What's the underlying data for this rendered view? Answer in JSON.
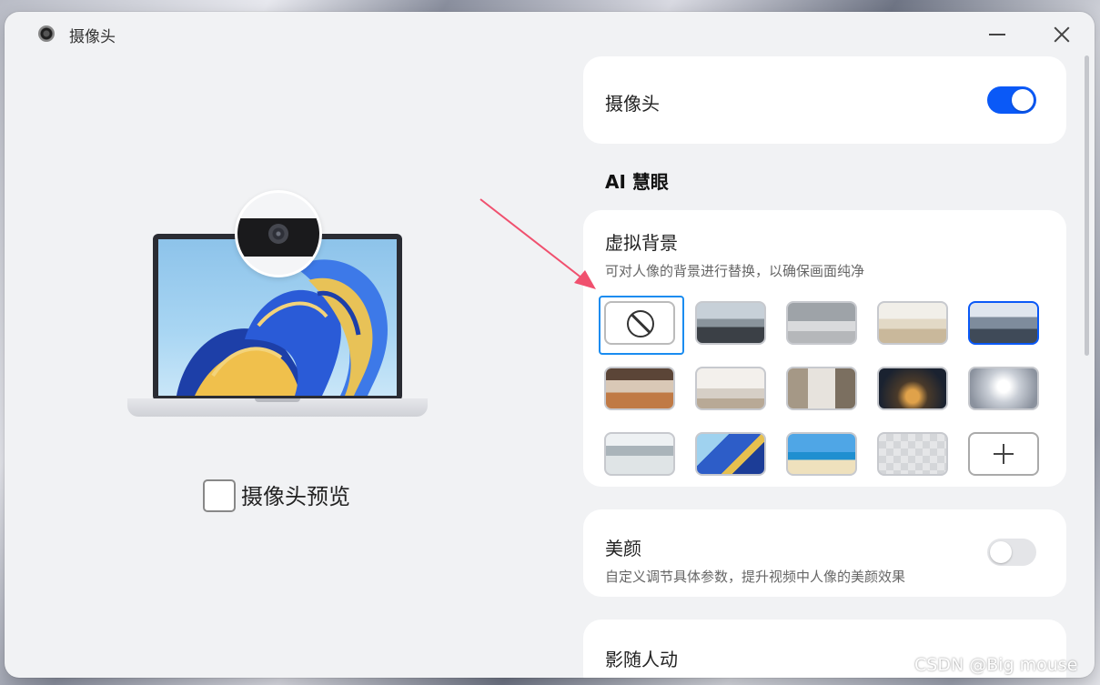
{
  "window": {
    "title": "摄像头",
    "icon": "camera-icon"
  },
  "preview": {
    "checkbox_label": "摄像头预览",
    "checked": false
  },
  "camera_card": {
    "label": "摄像头",
    "enabled": true
  },
  "ai_section": {
    "title": "AI 慧眼"
  },
  "virtual_background": {
    "title": "虚拟背景",
    "description": "可对人像的背景进行替换，以确保画面纯净",
    "selected_index": 4,
    "thumbnails": [
      {
        "name": "none",
        "icon": "ban-icon"
      },
      {
        "name": "meeting-room-glass"
      },
      {
        "name": "conference-room-gray"
      },
      {
        "name": "open-office-bright"
      },
      {
        "name": "office-city-view"
      },
      {
        "name": "cafe-interior"
      },
      {
        "name": "living-room-white"
      },
      {
        "name": "living-room-modern"
      },
      {
        "name": "city-night-aerial"
      },
      {
        "name": "futuristic-corridor"
      },
      {
        "name": "ink-mountain-landscape"
      },
      {
        "name": "blue-abstract-wave"
      },
      {
        "name": "tropical-beach"
      },
      {
        "name": "transparent-blur"
      },
      {
        "name": "add",
        "icon": "plus-icon"
      }
    ]
  },
  "beauty_card": {
    "title": "美颜",
    "description": "自定义调节具体参数，提升视频中人像的美颜效果",
    "enabled": false
  },
  "follow_card": {
    "title": "影随人动"
  },
  "watermark": "CSDN @Big mouse",
  "colors": {
    "accent": "#0a59f7",
    "focus": "#1a8cf0",
    "arrow": "#f0506e"
  }
}
